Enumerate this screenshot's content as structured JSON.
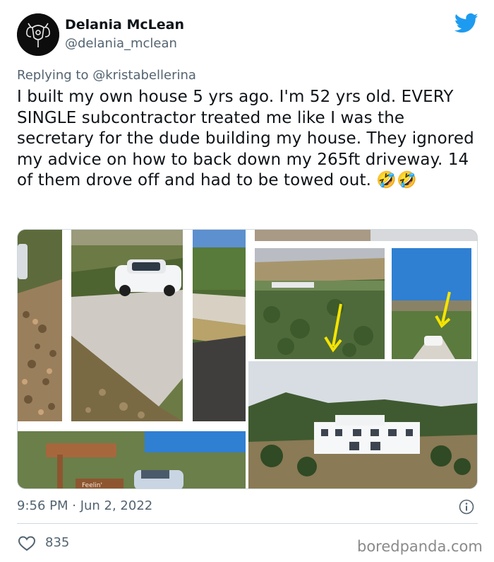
{
  "author": {
    "name": "Delania McLean",
    "handle": "@delania_mclean"
  },
  "reply": {
    "prefix": "Replying to ",
    "mention": "@kristabellerina"
  },
  "tweet": {
    "text": "I built my own house 5 yrs ago. I'm 52 yrs old. EVERY SINGLE subcontractor treated me like I was the secretary for the dude building my house. They ignored my advice on how to back down my 265ft driveway. 14 of them drove off and had to be towed out. 🤣🤣",
    "timestamp": "9:56 PM · Jun 2, 2022",
    "likes": "835"
  },
  "media": {
    "sign_text": "Feelin'"
  },
  "watermark": "boredpanda.com",
  "colors": {
    "twitter_blue": "#1d9bf0",
    "secondary_text": "#536471",
    "annotation_arrow": "#f5e400"
  },
  "icons": [
    "twitter-bird-icon",
    "info-icon",
    "heart-icon"
  ]
}
